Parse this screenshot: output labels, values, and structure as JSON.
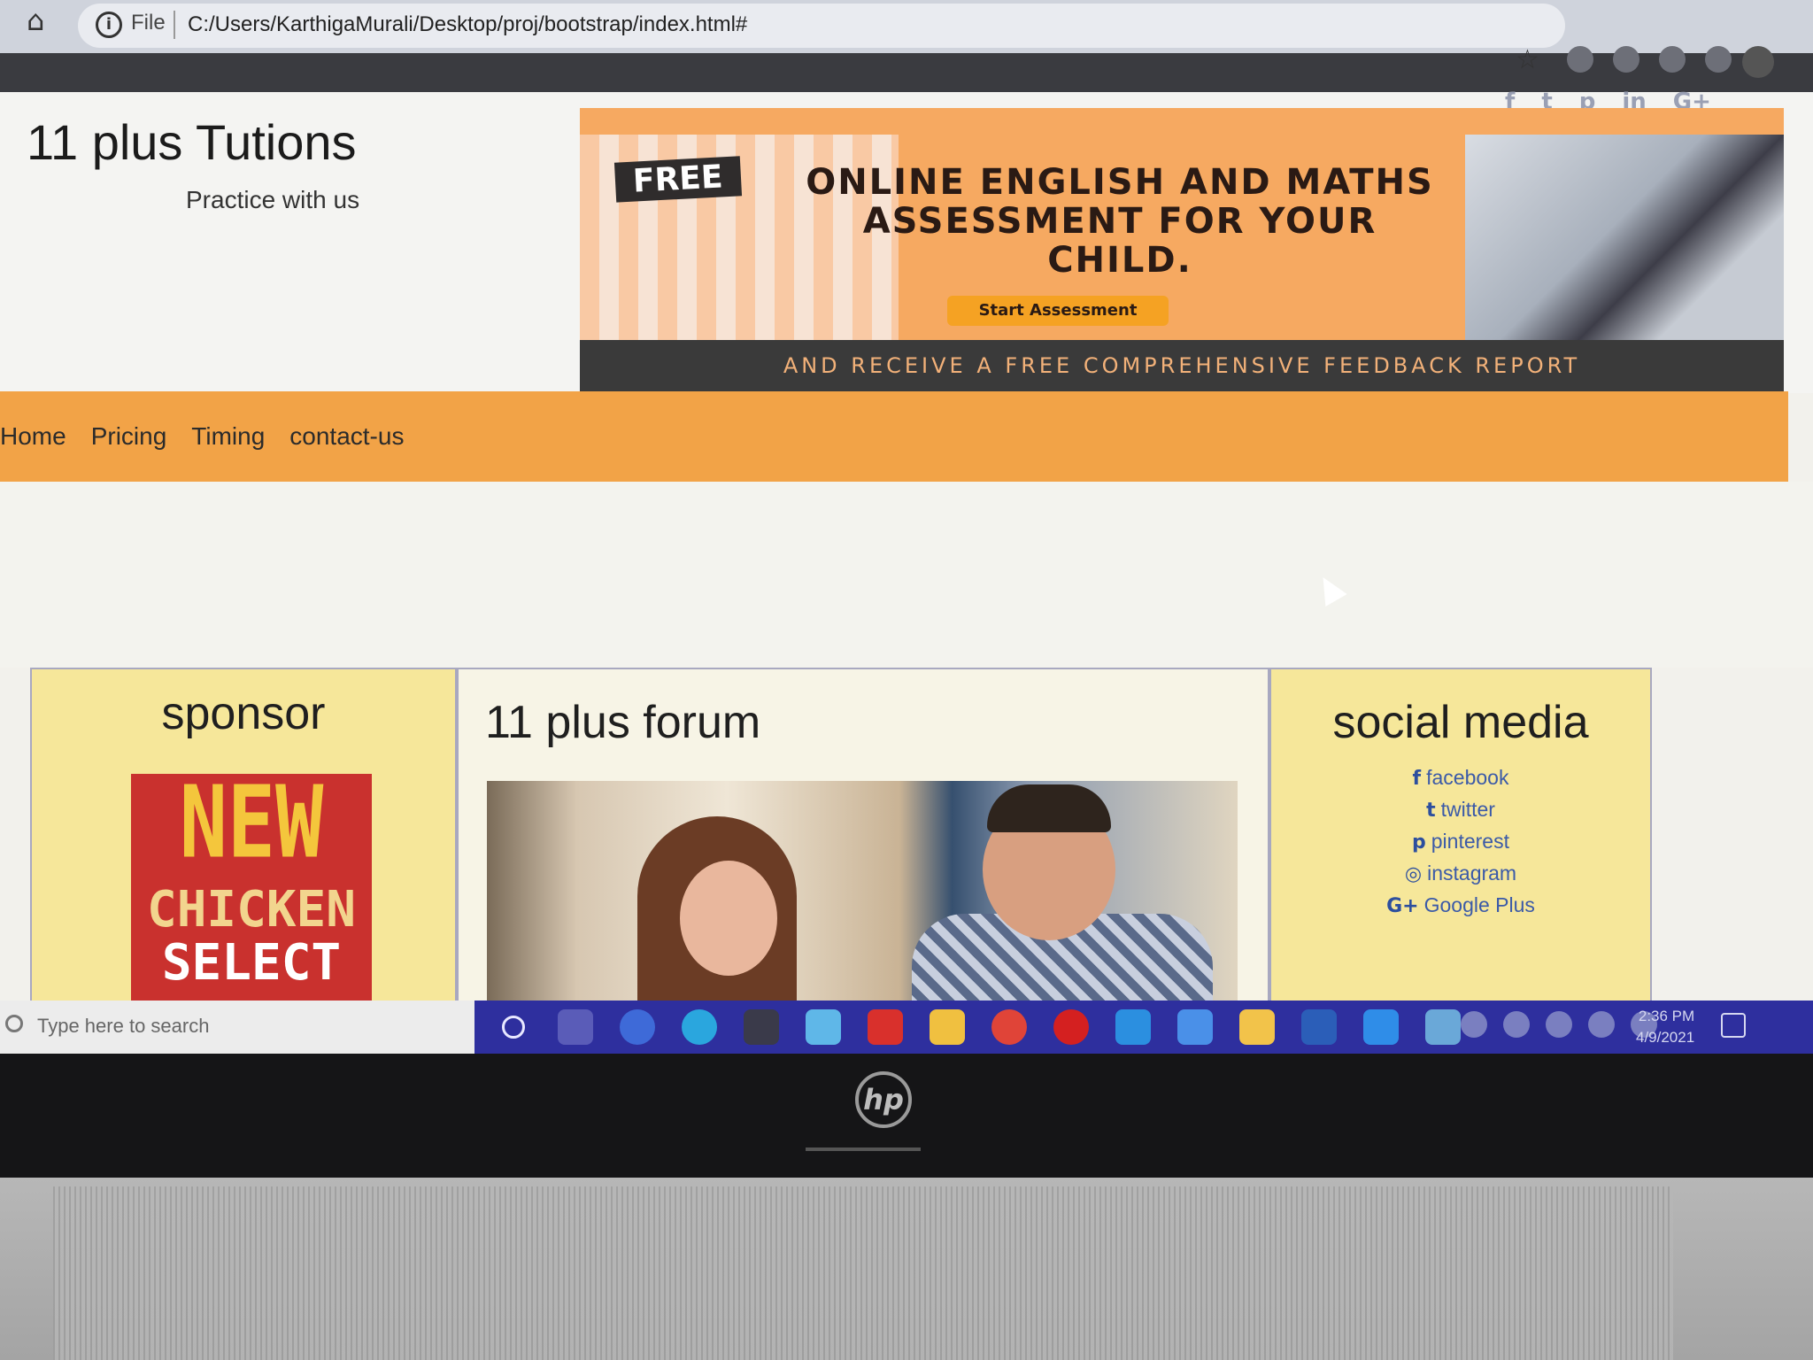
{
  "browser": {
    "file_label": "File",
    "url": "C:/Users/KarthigaMurali/Desktop/proj/bootstrap/index.html#"
  },
  "site": {
    "title": "11 plus Tutions",
    "subtitle": "Practice with us",
    "top_social_icons": [
      "facebook-icon",
      "twitter-icon",
      "pinterest-icon",
      "linkedin-icon",
      "google-plus-icon"
    ],
    "top_social_glyphs": [
      "f",
      "t",
      "p",
      "in",
      "G+"
    ]
  },
  "banner": {
    "free_tag": "FREE",
    "headline": "ONLINE ENGLISH AND MATHS ASSESSMENT FOR YOUR CHILD.",
    "button": "Start Assessment",
    "strip": "AND RECEIVE A FREE COMPREHENSIVE FEEDBACK REPORT"
  },
  "nav": {
    "items": [
      "Home",
      "Pricing",
      "Timing",
      "contact-us"
    ]
  },
  "sponsor": {
    "heading": "sponsor",
    "ad_line1": "NEW",
    "ad_line2": "CHICKEN",
    "ad_line3": "SELECT"
  },
  "forum": {
    "heading": "11 plus forum"
  },
  "social": {
    "heading": "social media",
    "links": [
      {
        "label": "facebook",
        "glyph": "f"
      },
      {
        "label": "twitter",
        "glyph": "t"
      },
      {
        "label": "pinterest",
        "glyph": "p"
      },
      {
        "label": "instagram",
        "glyph": "◎"
      },
      {
        "label": "Google Plus",
        "glyph": "G+"
      }
    ]
  },
  "taskbar": {
    "search_placeholder": "Type here to search",
    "time": "2:36 PM",
    "date": "4/9/2021"
  },
  "colors": {
    "nav_bg": "#f2a347",
    "card_yellow": "#f6e79a",
    "link_blue": "#3b5aa8",
    "taskbar": "#2e2f9e"
  }
}
